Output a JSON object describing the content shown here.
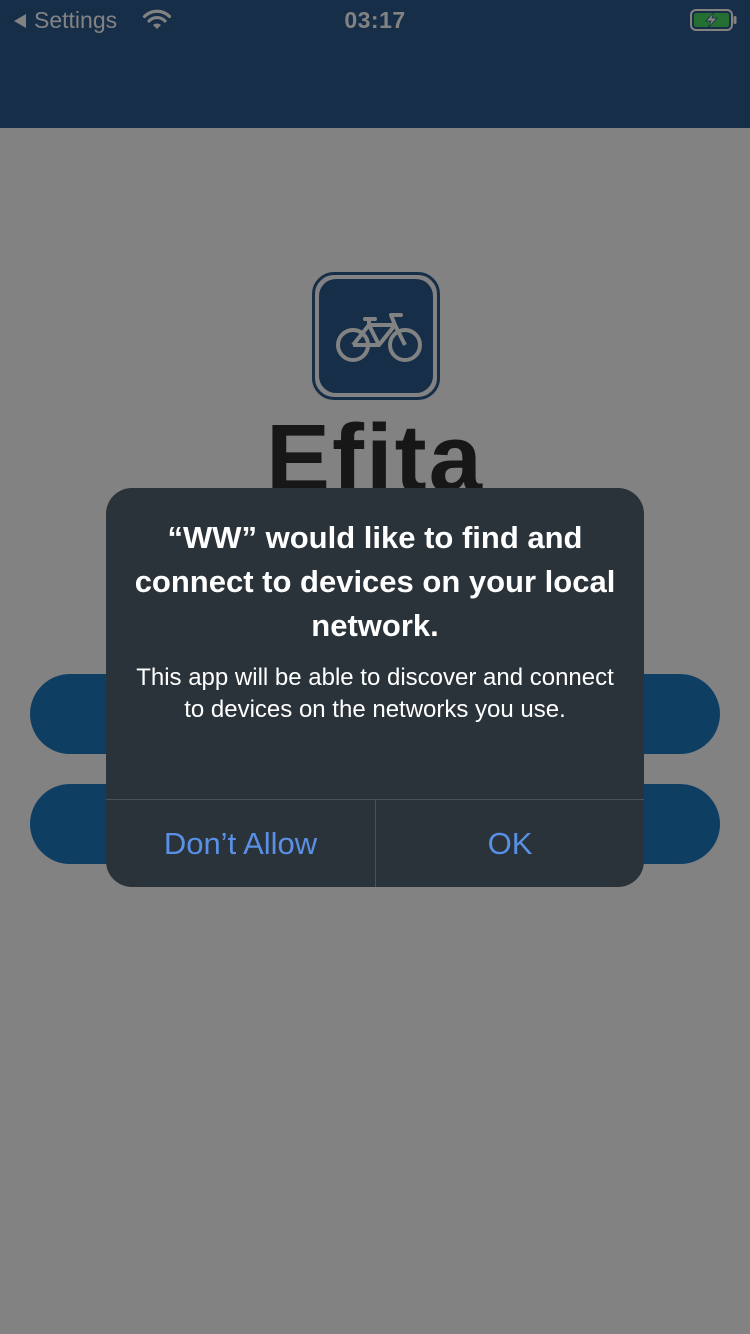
{
  "status_bar": {
    "back_label": "Settings",
    "time": "03:17",
    "battery_charging": true
  },
  "app": {
    "brand_name": "Efita",
    "logo_icon": "bicycle-icon",
    "colors": {
      "nav": "#2c5a8e",
      "pill": "#1e7ac2"
    }
  },
  "alert": {
    "title": "“WW” would like to find and connect to devices on your local network.",
    "message": "This app will be able to discover and connect to devices on the networks you use.",
    "deny_label": "Don’t Allow",
    "ok_label": "OK",
    "button_color": "#5a8fe6"
  }
}
